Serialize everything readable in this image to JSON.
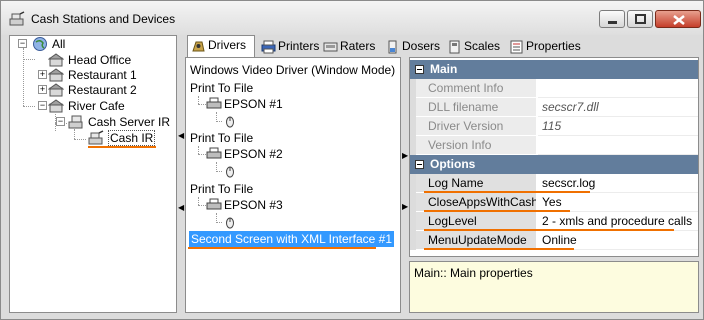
{
  "window": {
    "title": "Cash Stations and Devices",
    "accent_color": "#f07000",
    "selection_color": "#3399ff",
    "section_color": "#627d9c",
    "help_bg_color": "#fdfcdf"
  },
  "tree": {
    "root": "All",
    "items": {
      "head_office": "Head Office",
      "restaurant_1": "Restaurant 1",
      "restaurant_2": "Restaurant 2",
      "river_cafe": "River Cafe",
      "cash_server": "Cash Server IR",
      "cash_ir": "Cash IR"
    }
  },
  "tabs": {
    "drivers": "Drivers",
    "printers": "Printers",
    "raters": "Raters",
    "dosers": "Dosers",
    "scales": "Scales",
    "properties": "Properties"
  },
  "drivers": {
    "video_driver": "Windows Video Driver (Window Mode)",
    "groups": [
      {
        "label": "Print To File",
        "printer": "EPSON #1"
      },
      {
        "label": "Print To File",
        "printer": "EPSON #2"
      },
      {
        "label": "Print To File",
        "printer": "EPSON #3"
      }
    ],
    "selected": "Second Screen with XML Interface #1"
  },
  "properties": {
    "main_section": "Main",
    "main_rows": [
      {
        "name": "Comment Info",
        "value": ""
      },
      {
        "name": "DLL filename",
        "value": "secscr7.dll"
      },
      {
        "name": "Driver Version",
        "value": "115"
      },
      {
        "name": "Version Info",
        "value": ""
      }
    ],
    "options_section": "Options",
    "options_rows": [
      {
        "name": "Log Name",
        "value": "secscr.log"
      },
      {
        "name": "CloseAppsWithCashSI",
        "value": "Yes"
      },
      {
        "name": "LogLevel",
        "value": "2 - xmls and procedure calls"
      },
      {
        "name": "MenuUpdateMode",
        "value": "Online"
      }
    ]
  },
  "help": {
    "text": "Main:: Main properties"
  }
}
